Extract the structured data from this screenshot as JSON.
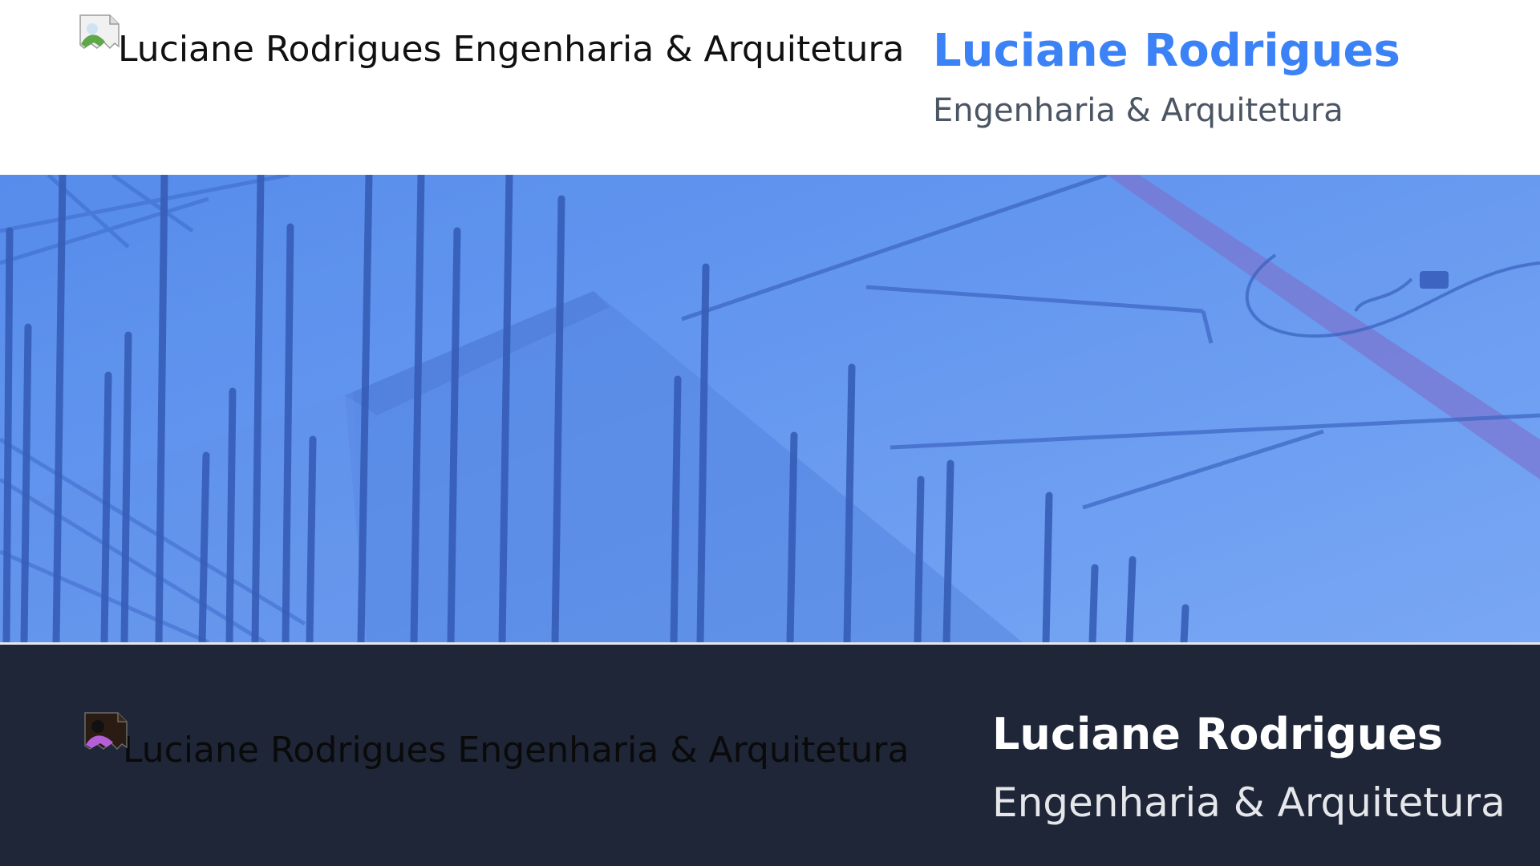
{
  "header": {
    "logo_alt": "Luciane Rodrigues Engenharia & Arquitetura",
    "brand_name": "Luciane Rodrigues",
    "brand_tagline": "Engenharia & Arquitetura",
    "brand_color": "#3b82f6",
    "tagline_color": "#4b5563"
  },
  "hero": {
    "image": "construction-rebar-photo",
    "overlay_color": "#3b82f6"
  },
  "footer": {
    "logo_alt": "Luciane Rodrigues Engenharia & Arquitetura",
    "brand_name": "Luciane Rodrigues",
    "brand_tagline": "Engenharia & Arquitetura",
    "background_color": "#1e2637"
  },
  "icons": {
    "broken_image": "broken-image-icon"
  }
}
